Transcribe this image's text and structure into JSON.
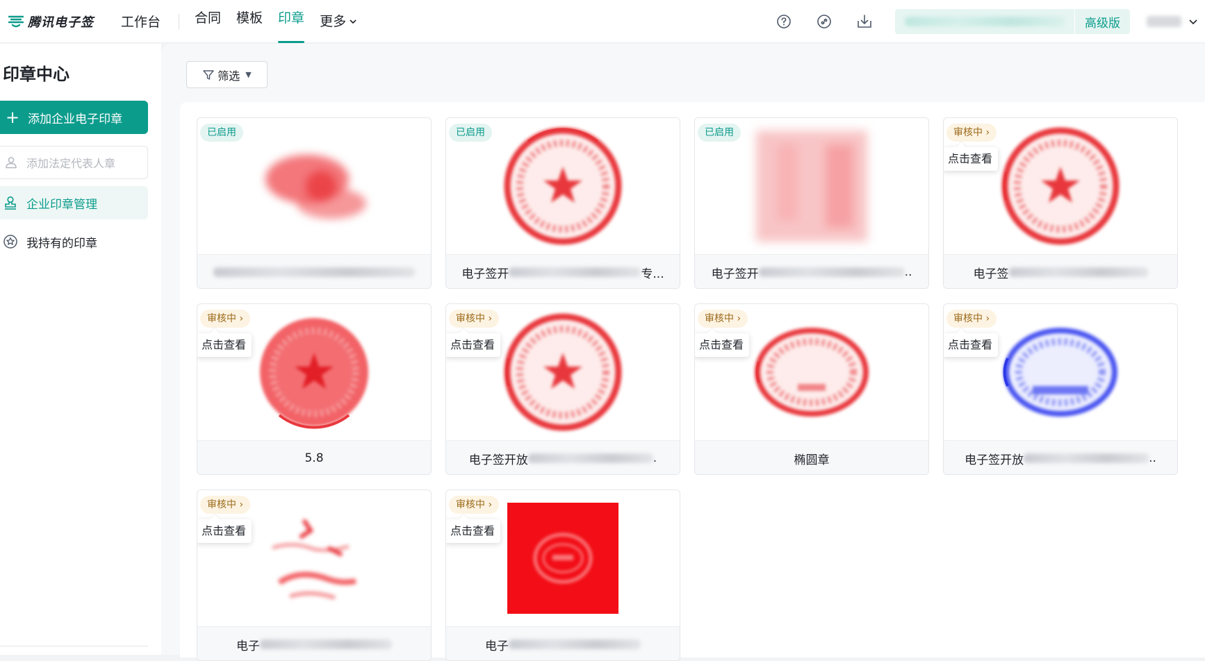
{
  "app": {
    "brand_name": "腾讯电子签",
    "workbench_label": "工作台"
  },
  "nav": {
    "items": [
      {
        "label": "合同"
      },
      {
        "label": "模板"
      },
      {
        "label": "印章"
      }
    ],
    "more_label": "更多",
    "active": "印章"
  },
  "topbar_right": {
    "plan_label": "高级版",
    "icons": [
      "help-icon",
      "link-icon",
      "download-icon"
    ]
  },
  "sidebar": {
    "title": "印章中心",
    "add_seal_label": "添加企业电子印章",
    "add_legal_seal_label": "添加法定代表人章",
    "menu": [
      {
        "label": "企业印章管理",
        "active": true
      },
      {
        "label": "我持有的印章",
        "active": false
      }
    ]
  },
  "toolbar": {
    "filter_label": "筛选"
  },
  "colors": {
    "accent": "#0c9c8c",
    "seal_red": "#e8383d",
    "seal_blue": "#4a55f0"
  },
  "seals": [
    {
      "status": "已启用",
      "view_tip": "",
      "name_visible": "",
      "name_suffix": "",
      "seal_type": "blurred-red-irregular"
    },
    {
      "status": "已启用",
      "view_tip": "",
      "name_visible": "电子签开",
      "name_suffix": "专...",
      "seal_type": "round-red-star"
    },
    {
      "status": "已启用",
      "view_tip": "",
      "name_visible": "电子签开",
      "name_suffix": "..",
      "seal_type": "blurred-red-square"
    },
    {
      "status": "审核中",
      "view_tip": "点击查看",
      "name_visible": "电子签",
      "name_suffix": "",
      "seal_type": "round-red-star"
    },
    {
      "status": "审核中",
      "view_tip": "点击查看",
      "name_visible": "5.8",
      "name_suffix": "",
      "seal_type": "round-red-star"
    },
    {
      "status": "审核中",
      "view_tip": "点击查看",
      "name_visible": "电子签开放",
      "name_suffix": ".",
      "seal_type": "round-red-star"
    },
    {
      "status": "审核中",
      "view_tip": "点击查看",
      "name_visible": "椭圆章",
      "name_suffix": "",
      "seal_type": "oval-red"
    },
    {
      "status": "审核中",
      "view_tip": "点击查看",
      "name_visible": "电子签开放",
      "name_suffix": "..",
      "seal_type": "oval-blue"
    },
    {
      "status": "审核中",
      "view_tip": "点击查看",
      "name_visible": "电子",
      "name_suffix": "",
      "seal_type": "handwritten-red"
    },
    {
      "status": "审核中",
      "view_tip": "点击查看",
      "name_visible": "电子",
      "name_suffix": "",
      "seal_type": "square-red-solid"
    }
  ]
}
